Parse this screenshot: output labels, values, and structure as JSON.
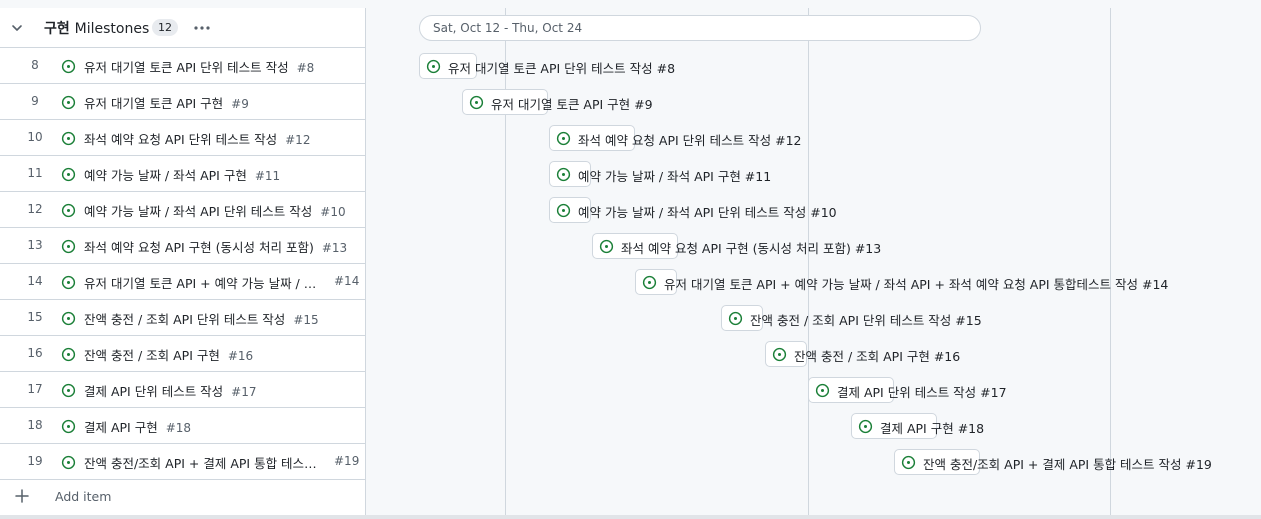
{
  "group": {
    "name_ko": "구현",
    "name_en": "Milestones",
    "count": "12"
  },
  "rows": [
    {
      "num": "8",
      "title": "유저 대기열 토큰 API 단위 테스트 작성",
      "id": "#8"
    },
    {
      "num": "9",
      "title": "유저 대기열 토큰 API 구현",
      "id": "#9"
    },
    {
      "num": "10",
      "title": "좌석 예약 요청 API 단위 테스트 작성",
      "id": "#12"
    },
    {
      "num": "11",
      "title": "예약 가능 날짜 / 좌석 API 구현",
      "id": "#11"
    },
    {
      "num": "12",
      "title": "예약 가능 날짜 / 좌석 API 단위 테스트 작성",
      "id": "#10"
    },
    {
      "num": "13",
      "title": "좌석 예약 요청 API 구현 (동시성 처리 포함)",
      "id": "#13"
    },
    {
      "num": "14",
      "title": "유저 대기열 토큰 API + 예약 가능 날짜 / 좌...",
      "id": "#14"
    },
    {
      "num": "15",
      "title": "잔액 충전 / 조회 API 단위 테스트 작성",
      "id": "#15"
    },
    {
      "num": "16",
      "title": "잔액 충전 / 조회 API 구현",
      "id": "#16"
    },
    {
      "num": "17",
      "title": "결제 API 단위 테스트 작성",
      "id": "#17"
    },
    {
      "num": "18",
      "title": "결제 API 구현",
      "id": "#18"
    },
    {
      "num": "19",
      "title": "잔액 충전/조회 API + 결제 API 통합 테스트 ...",
      "id": "#19"
    }
  ],
  "add_item_label": "Add item",
  "timeline": {
    "range_label": "Sat, Oct 12 - Thu, Oct 24",
    "bars": [
      {
        "label": "유저 대기열 토큰 API 단위 테스트 작성 #8"
      },
      {
        "label": "유저 대기열 토큰 API 구현 #9"
      },
      {
        "label": "좌석 예약 요청 API 단위 테스트 작성 #12"
      },
      {
        "label": "예약 가능 날짜 / 좌석 API 구현 #11"
      },
      {
        "label": "예약 가능 날짜 / 좌석 API 단위 테스트 작성 #10"
      },
      {
        "label": "좌석 예약 요청 API 구현 (동시성 처리 포함) #13"
      },
      {
        "label": "유저 대기열 토큰 API + 예약 가능 날짜 / 좌석 API + 좌석 예약 요청 API 통합테스트 작성 #14"
      },
      {
        "label": "잔액 충전 / 조회 API 단위 테스트 작성 #15"
      },
      {
        "label": "잔액 충전 / 조회 API 구현 #16"
      },
      {
        "label": "결제 API 단위 테스트 작성 #17"
      },
      {
        "label": "결제 API 구현 #18"
      },
      {
        "label": "잔액 충전/조회 API + 결제 API 통합 테스트 작성 #19"
      }
    ]
  },
  "colors": {
    "open_issue": "#1a7f37",
    "border": "#d0d7de",
    "muted_text": "#57606a"
  },
  "icons": {
    "collapse": "chevron-down-icon",
    "more": "kebab-horizontal-icon",
    "issue": "issue-opened-icon",
    "add": "plus-icon"
  }
}
